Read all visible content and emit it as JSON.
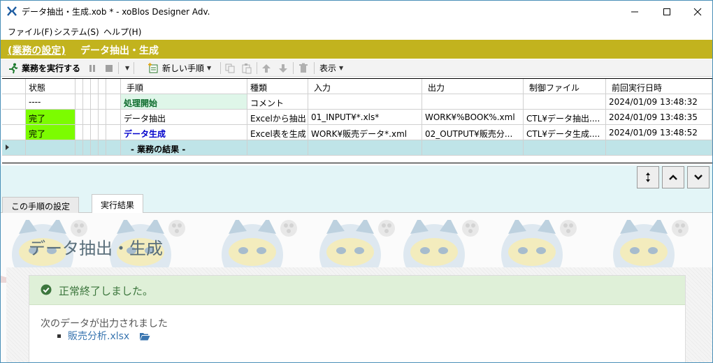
{
  "window": {
    "title": "データ抽出・生成.xob * - xoBlos Designer Adv."
  },
  "menu": {
    "items": [
      "ファイル(F)",
      "システム(S)",
      "ヘルプ(H)"
    ]
  },
  "business": {
    "settings_link": "(業務の設定)",
    "title": "データ抽出・生成"
  },
  "toolbar": {
    "run_label": "業務を実行する",
    "new_step_label": "新しい手順",
    "view_label": "表示"
  },
  "grid": {
    "columns": [
      "状態",
      "手順",
      "種類",
      "入力",
      "出力",
      "制御ファイル",
      "前回実行日時"
    ],
    "rows": [
      {
        "status": "----",
        "step": "処理開始",
        "type": "コメント",
        "input": "",
        "output": "",
        "control": "",
        "last_run": "2024/01/09 13:48:32"
      },
      {
        "status": "完了",
        "step": "データ抽出",
        "type": "Excelから抽出",
        "input": "01_INPUT¥*.xls*",
        "output": "WORK¥%BOOK%.xml",
        "control": "CTL¥データ抽出....",
        "last_run": "2024/01/09 13:48:35"
      },
      {
        "status": "完了",
        "step": "データ生成",
        "type": "Excel表を生成",
        "input": "WORK¥販売データ*.xml",
        "output": "02_OUTPUT¥販売分...",
        "control": "CTL¥データ生成....",
        "last_run": "2024/01/09 13:48:52"
      }
    ],
    "result_row_label": "- 業務の結果 -"
  },
  "tabs": [
    "この手順の設定",
    "実行結果"
  ],
  "result": {
    "heading": "データ抽出・生成",
    "success_message": "正常終了しました。",
    "output_message": "次のデータが出力されました",
    "output_file": "販売分析.xlsx"
  },
  "colors": {
    "business_bar": "#c2b31e",
    "status_done": "#7cfc00",
    "result_row": "#bfe4e8",
    "success_bg": "#dff0d8"
  }
}
